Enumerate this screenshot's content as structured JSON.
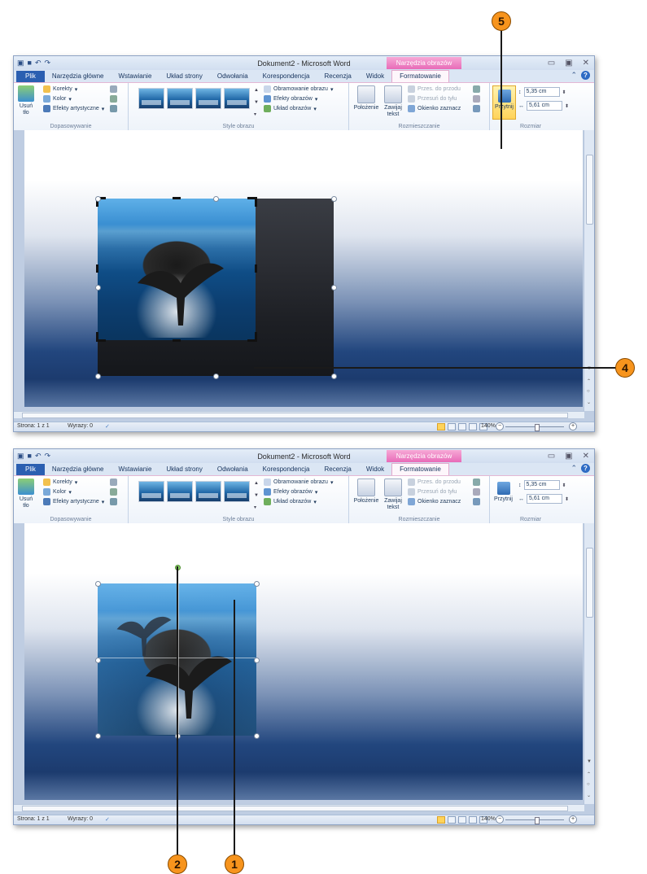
{
  "screens": [
    {
      "doc_title": "Dokument2 - Microsoft Word",
      "context_tab_header": "Narzędzia obrazów",
      "tabs": [
        "Plik",
        "Narzędzia główne",
        "Wstawianie",
        "Układ strony",
        "Odwołania",
        "Korespondencja",
        "Recenzja",
        "Widok",
        "Formatowanie"
      ],
      "active_tab": "Formatowanie",
      "groups": {
        "adjust": {
          "label": "Dopasowywanie",
          "remove_bg": "Usuń tło",
          "items": [
            "Korekty",
            "Kolor",
            "Efekty artystyczne"
          ]
        },
        "styles": {
          "label": "Style obrazu",
          "items": [
            "Obramowanie obrazu",
            "Efekty obrazów",
            "Układ obrazów"
          ]
        },
        "arrange": {
          "label": "Rozmieszczanie",
          "position": "Położenie",
          "wrap": "Zawijaj tekst",
          "items": [
            "Przes. do przodu",
            "Przesuń do tyłu",
            "Okienko zaznacz"
          ]
        },
        "size": {
          "label": "Rozmiar",
          "crop": "Przytnij",
          "height": "5,35 cm",
          "width": "5,61 cm"
        }
      },
      "status": {
        "page": "Strona: 1 z 1",
        "words": "Wyrazy: 0",
        "zoom": "140%"
      }
    },
    {
      "doc_title": "Dokument2 - Microsoft Word",
      "context_tab_header": "Narzędzia obrazów",
      "tabs": [
        "Plik",
        "Narzędzia główne",
        "Wstawianie",
        "Układ strony",
        "Odwołania",
        "Korespondencja",
        "Recenzja",
        "Widok",
        "Formatowanie"
      ],
      "active_tab": "Formatowanie",
      "groups": {
        "adjust": {
          "label": "Dopasowywanie",
          "remove_bg": "Usuń tło",
          "items": [
            "Korekty",
            "Kolor",
            "Efekty artystyczne"
          ]
        },
        "styles": {
          "label": "Style obrazu",
          "items": [
            "Obramowanie obrazu",
            "Efekty obrazów",
            "Układ obrazów"
          ]
        },
        "arrange": {
          "label": "Rozmieszczanie",
          "position": "Położenie",
          "wrap": "Zawijaj tekst",
          "items": [
            "Przes. do przodu",
            "Przesuń do tyłu",
            "Okienko zaznacz"
          ]
        },
        "size": {
          "label": "Rozmiar",
          "crop": "Przytnij",
          "height": "5,35 cm",
          "width": "5,61 cm"
        }
      },
      "status": {
        "page": "Strona: 1 z 1",
        "words": "Wyrazy: 0",
        "zoom": "140%"
      }
    }
  ],
  "callouts": [
    "5",
    "4",
    "2",
    "1"
  ],
  "colors": {
    "callout": "#f7941d",
    "context_tab": "#e86bb8",
    "file_tab": "#2b5fb1",
    "highlight": "#ffd35a"
  }
}
